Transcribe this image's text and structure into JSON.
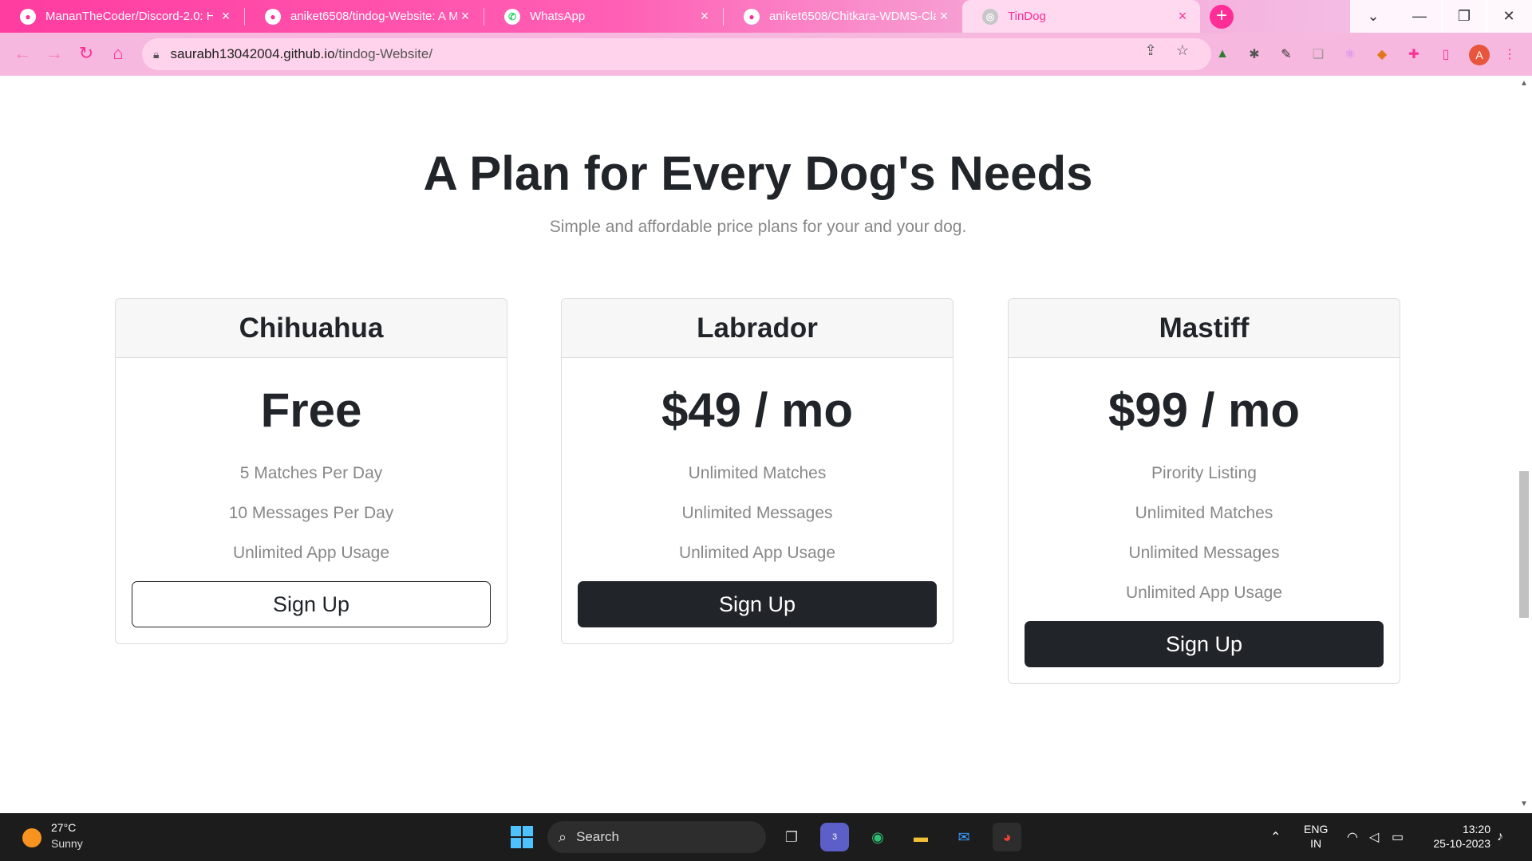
{
  "browser": {
    "tabs": [
      {
        "title": "MananTheCoder/Discord-2.0: H",
        "icon": "github-icon"
      },
      {
        "title": "aniket6508/tindog-Website: A M",
        "icon": "github-icon"
      },
      {
        "title": "WhatsApp",
        "icon": "whatsapp-icon"
      },
      {
        "title": "aniket6508/Chitkara-WDMS-Cla",
        "icon": "github-icon"
      },
      {
        "title": "TinDog",
        "icon": "globe-icon",
        "active": true
      }
    ],
    "new_tab": "+",
    "close_glyph": "×",
    "url_host": "saurabh13042004.github.io",
    "url_path": "/tindog-Website/",
    "profile_initial": "A",
    "accent_color": "#ff2d96"
  },
  "pricing": {
    "title": "A Plan for Every Dog's Needs",
    "subtitle": "Simple and affordable price plans for your and your dog.",
    "plans": [
      {
        "name": "Chihuahua",
        "price": "Free",
        "features": [
          "5 Matches Per Day",
          "10 Messages Per Day",
          "Unlimited App Usage"
        ],
        "button": "Sign Up",
        "button_style": "outline"
      },
      {
        "name": "Labrador",
        "price": "$49 / mo",
        "features": [
          "Unlimited Matches",
          "Unlimited Messages",
          "Unlimited App Usage"
        ],
        "button": "Sign Up",
        "button_style": "dark"
      },
      {
        "name": "Mastiff",
        "price": "$99 / mo",
        "features": [
          "Pirority Listing",
          "Unlimited Matches",
          "Unlimited Messages",
          "Unlimited App Usage"
        ],
        "button": "Sign Up",
        "button_style": "dark"
      }
    ]
  },
  "taskbar": {
    "weather_temp": "27°C",
    "weather_desc": "Sunny",
    "search": "Search",
    "chat_badge": "3",
    "lang_line1": "ENG",
    "lang_line2": "IN",
    "time": "13:20",
    "date": "25-10-2023"
  }
}
